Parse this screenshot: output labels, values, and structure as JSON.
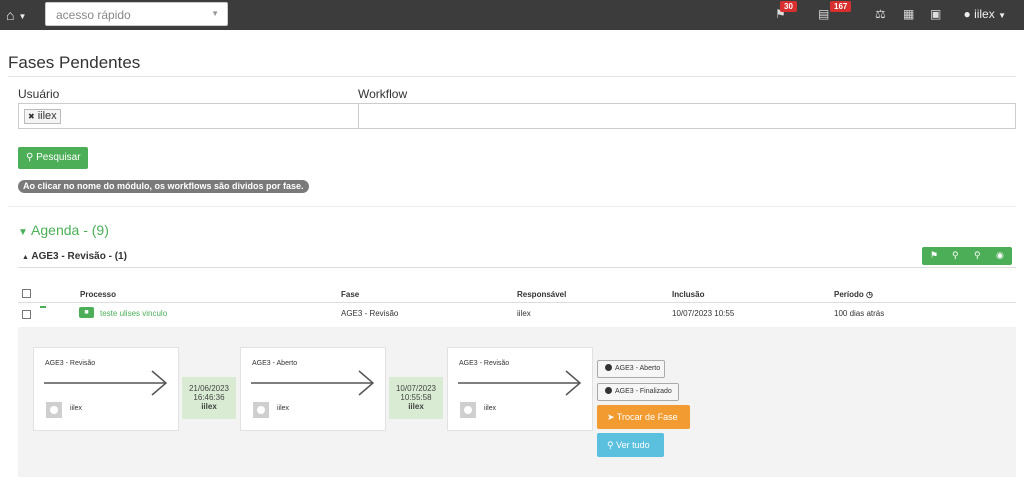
{
  "topbar": {
    "quick_access": "acesso rápido",
    "flag_count": "30",
    "money_count": "167",
    "user": "iilex"
  },
  "page": {
    "title": "Fases Pendentes",
    "usuario_label": "Usuário",
    "usuario_tag": "iilex",
    "workflow_label": "Workflow",
    "search_button": "Pesquisar",
    "hint": "Ao clicar no nome do módulo, os workflows são dividos por fase."
  },
  "group": {
    "title": "Agenda - (9)",
    "subgroup": "AGE3 - Revisão - (1)"
  },
  "table": {
    "headers": [
      "Processo",
      "Fase",
      "Responsável",
      "Inclusão",
      "Período"
    ],
    "row": {
      "processo": "teste ulises vinculo",
      "fase": "AGE3 - Revisão",
      "responsavel": "iilex",
      "inclusao": "10/07/2023 10:55",
      "periodo": "100 dias atrás"
    }
  },
  "flow": {
    "cards": [
      {
        "fase": "AGE3 - Revisão",
        "user": "iilex"
      },
      {
        "fase": "AGE3 - Aberto",
        "user": "iilex"
      },
      {
        "fase": "AGE3 - Revisão",
        "user": "iilex"
      }
    ],
    "stamps": [
      {
        "date": "21/06/2023",
        "time": "16:46:36",
        "user": "iilex"
      },
      {
        "date": "10/07/2023",
        "time": "10:55:58",
        "user": "iilex"
      }
    ],
    "actions": {
      "option1": "AGE3 - Aberto",
      "option2": "AGE3 - Finalizado",
      "change_phase": "Trocar de Fase",
      "see_all": "Ver tudo"
    }
  },
  "colors": {
    "green": "#4caf58",
    "orange": "#f29b30",
    "blue": "#5bc0de",
    "badge_red": "#d8302e",
    "topbar": "#3c3c3c"
  }
}
